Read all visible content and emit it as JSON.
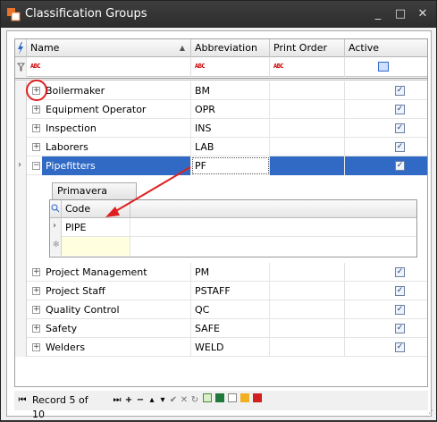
{
  "window": {
    "title": "Classification Groups",
    "minimize": "_",
    "maximize": "□",
    "close": "✕"
  },
  "columns": {
    "name": "Name",
    "abbreviation": "Abbreviation",
    "print_order": "Print Order",
    "active": "Active"
  },
  "filter_icon_text": "ABC",
  "rows": [
    {
      "name": "Boilermaker",
      "abbr": "BM",
      "active": true
    },
    {
      "name": "Equipment Operator",
      "abbr": "OPR",
      "active": true
    },
    {
      "name": "Inspection",
      "abbr": "INS",
      "active": true
    },
    {
      "name": "Laborers",
      "abbr": "LAB",
      "active": true
    },
    {
      "name": "Pipefitters",
      "abbr": "PF",
      "active": true,
      "selected": true
    },
    {
      "name": "Project Management",
      "abbr": "PM",
      "active": true
    },
    {
      "name": "Project Staff",
      "abbr": "PSTAFF",
      "active": true
    },
    {
      "name": "Quality Control",
      "abbr": "QC",
      "active": true
    },
    {
      "name": "Safety",
      "abbr": "SAFE",
      "active": true
    },
    {
      "name": "Welders",
      "abbr": "WELD",
      "active": true
    }
  ],
  "detail": {
    "tab_label": "Primavera Codes",
    "column": "Code",
    "rows": [
      "PIPE"
    ]
  },
  "status": {
    "record_text": "Record 5 of 10"
  },
  "colors": {
    "selection": "#316ac5",
    "annotation": "#e02020"
  }
}
